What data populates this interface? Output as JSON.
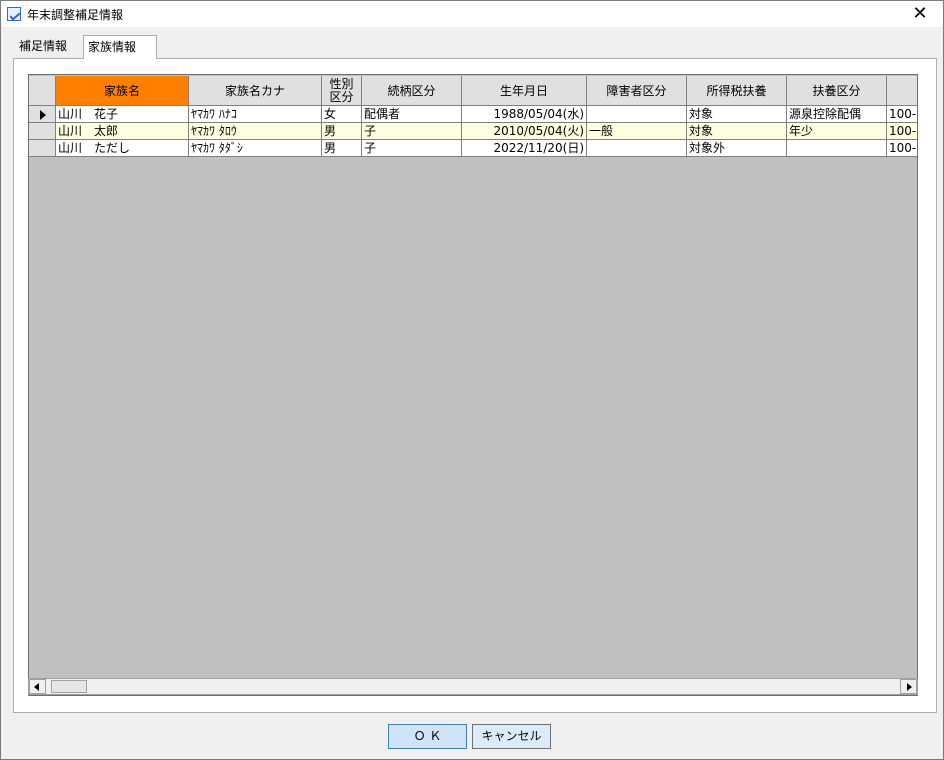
{
  "window": {
    "title": "年末調整補足情報",
    "close_glyph": "✕"
  },
  "tabs": [
    {
      "label": "補足情報"
    },
    {
      "label": "家族情報"
    }
  ],
  "grid": {
    "columns": [
      {
        "label": "家族名"
      },
      {
        "label": "家族名カナ"
      },
      {
        "label_line1": "性別",
        "label_line2": "区分"
      },
      {
        "label": "続柄区分"
      },
      {
        "label": "生年月日"
      },
      {
        "label": "障害者区分"
      },
      {
        "label": "所得税扶養"
      },
      {
        "label": "扶養区分"
      },
      {
        "label": ""
      }
    ],
    "rows": [
      {
        "name": "山川　花子",
        "kana": "ﾔﾏｶﾜ ﾊﾅｺ",
        "sex": "女",
        "relation": "配偶者",
        "birth": "1988/05/04(水)",
        "disability": "",
        "income_tax_dep": "対象",
        "dep_class": "源泉控除配偶",
        "extra": "100-"
      },
      {
        "name": "山川　太郎",
        "kana": "ﾔﾏｶﾜ ﾀﾛｳ",
        "sex": "男",
        "relation": "子",
        "birth": "2010/05/04(火)",
        "disability": "一般",
        "income_tax_dep": "対象",
        "dep_class": "年少",
        "extra": "100-"
      },
      {
        "name": "山川　ただし",
        "kana": "ﾔﾏｶﾜ ﾀﾀﾞｼ",
        "sex": "男",
        "relation": "子",
        "birth": "2022/11/20(日)",
        "disability": "",
        "income_tax_dep": "対象外",
        "dep_class": "",
        "extra": "100-"
      }
    ]
  },
  "buttons": {
    "ok": "Ｏ Ｋ",
    "cancel": "キャンセル"
  },
  "colors": {
    "active_header": "#ff8000",
    "alt_row": "#ffffe1",
    "grid_bg": "#c0c0c0"
  }
}
